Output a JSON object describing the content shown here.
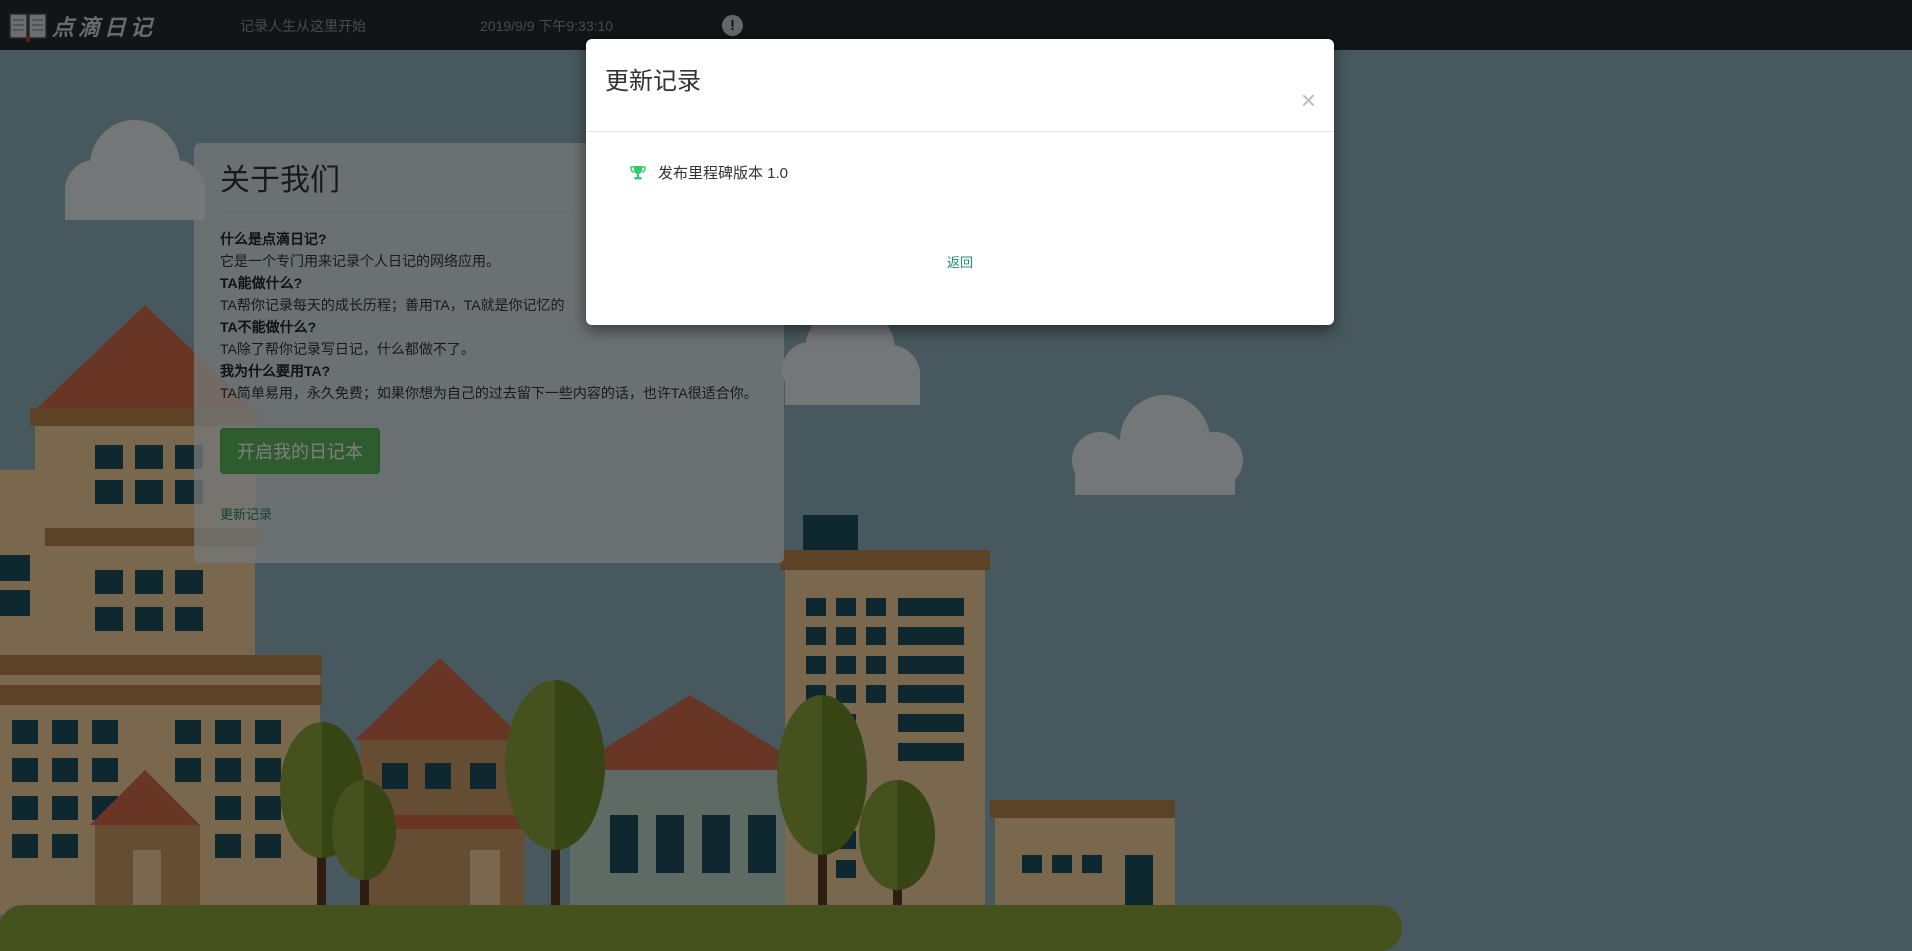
{
  "navbar": {
    "brand_text": "点滴日记",
    "slogan": "记录人生从这里开始",
    "datetime": "2019/9/9 下午9:33:10",
    "alert_icon": "exclamation-circle-icon",
    "alert_glyph": "!"
  },
  "about": {
    "title": "关于我们",
    "qa": [
      {
        "q": "什么是点滴日记?",
        "a": "它是一个专门用来记录个人日记的网络应用。"
      },
      {
        "q": "TA能做什么?",
        "a": "TA帮你记录每天的成长历程；善用TA，TA就是你记忆的"
      },
      {
        "q": "TA不能做什么?",
        "a": "TA除了帮你记录写日记，什么都做不了。"
      },
      {
        "q": "我为什么要用TA?",
        "a": "TA简单易用，永久免费；如果你想为自己的过去留下一些内容的话，也许TA很适合你。"
      }
    ],
    "start_button": "开启我的日记本",
    "changelog_link": "更新记录"
  },
  "modal": {
    "title": "更新记录",
    "close_glyph": "×",
    "items": [
      {
        "icon": "trophy-icon",
        "text": "发布里程碑版本 1.0"
      }
    ],
    "back_link": "返回"
  },
  "colors": {
    "navbar": "#222a2f",
    "accent_green": "#5cb85c",
    "link_green": "#1f8b64",
    "trophy_green": "#2ecc71"
  }
}
